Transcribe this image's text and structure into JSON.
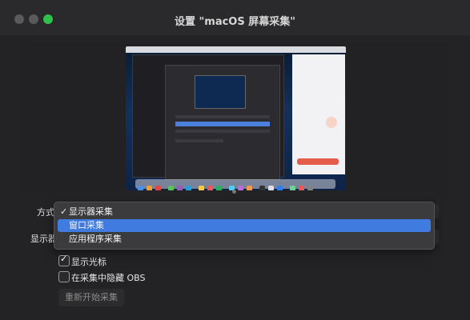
{
  "window": {
    "title": "设置 \"macOS 屏幕采集\""
  },
  "form": {
    "mode_label": "方式",
    "display_label": "显示器",
    "dropdown": {
      "options": [
        {
          "label": "显示器采集",
          "checked": true,
          "selected": false
        },
        {
          "label": "窗口采集",
          "checked": false,
          "selected": true
        },
        {
          "label": "应用程序采集",
          "checked": false,
          "selected": false
        }
      ],
      "highlight_color": "#3f7be0"
    },
    "checkboxes": [
      {
        "label": "显示光标",
        "checked": true
      },
      {
        "label": "在采集中隐藏 OBS",
        "checked": false
      }
    ],
    "restart_button": "重新开始采集"
  },
  "icons": {
    "check": "✓"
  }
}
